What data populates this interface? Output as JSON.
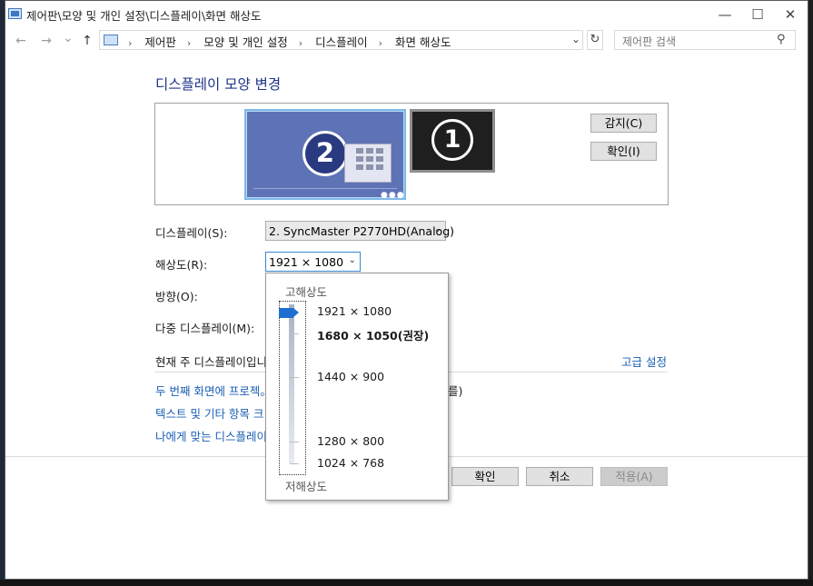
{
  "window": {
    "title": "제어판\\모양 및 개인 설정\\디스플레이\\화면 해상도",
    "controls": {
      "minimize": "—",
      "maximize": "☐",
      "close": "✕"
    }
  },
  "address": {
    "back": "←",
    "forward": "→",
    "recent": "⌄",
    "up": "↑",
    "crumbs": [
      "제어판",
      "모양 및 개인 설정",
      "디스플레이",
      "화면 해상도"
    ],
    "separator": "›",
    "refresh": "↻",
    "search_placeholder": "제어판 검색"
  },
  "page": {
    "heading": "디스플레이 모양 변경",
    "monitors": [
      {
        "number": "2",
        "selected": true
      },
      {
        "number": "1",
        "selected": false
      }
    ],
    "detect_label": "감지(C)",
    "identify_label": "확인(I)",
    "display_label": "디스플레이(S):",
    "display_value": "2. SyncMaster P2770HD(Analog)",
    "resolution_label": "해상도(R):",
    "resolution_value": "1921 × 1080",
    "orientation_label": "방향(O):",
    "multi_display_label": "다중 디스플레이(M):",
    "main_display_text": "현재 주 디스플레이입니",
    "advanced_link": "고급 설정",
    "links": [
      "두 번째 화면에 프로젝。",
      "텍스트 및 기타 항목 크",
      "나에게 맞는 디스플레이"
    ],
    "link_tail": "를)",
    "ok_label": "확인",
    "cancel_label": "취소",
    "apply_label": "적용(A)"
  },
  "dropdown": {
    "high_label": "고해상도",
    "low_label": "저해상도",
    "options": [
      {
        "label": "1921 × 1080",
        "recommended": false
      },
      {
        "label": "1680 × 1050(권장)",
        "recommended": true
      },
      {
        "label": "1440 × 900",
        "recommended": false
      },
      {
        "label": "1280 × 800",
        "recommended": false
      },
      {
        "label": "1024 × 768",
        "recommended": false
      }
    ],
    "selected_index": 0
  },
  "colors": {
    "heading": "#1e3287",
    "link": "#1a5fb4",
    "accent": "#1f6fd1",
    "monitor_selected": "#5e73b6",
    "monitor_other": "#1f1f1f"
  },
  "icons": [
    "computer-icon",
    "search-icon",
    "refresh-icon",
    "chevron-down-icon",
    "slider-thumb-icon"
  ]
}
